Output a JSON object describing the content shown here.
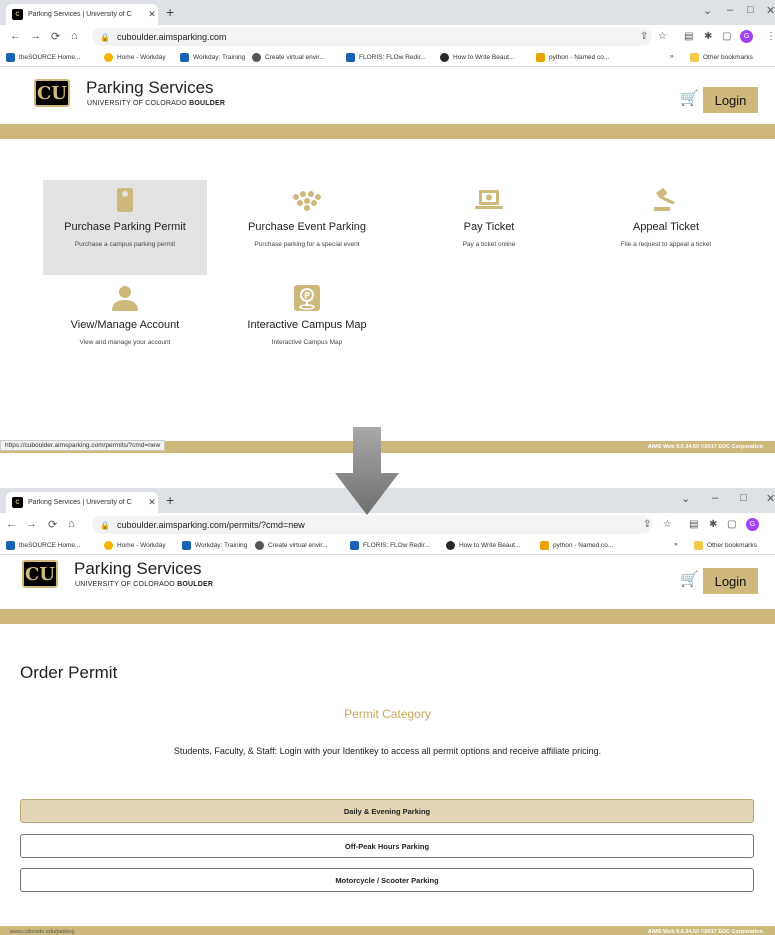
{
  "browser_before": {
    "tab_title": "Parking Services | University of C",
    "tab_close": "✕",
    "new_tab": "+",
    "url": "cuboulder.aimsparking.com",
    "status_url": "https://cuboulder.aimsparking.com/permits/?cmd=new"
  },
  "browser_after": {
    "tab_title": "Parking Services | University of C",
    "tab_close": "✕",
    "new_tab": "+",
    "url": "cuboulder.aimsparking.com/permits/?cmd=new"
  },
  "bookmarks": [
    {
      "label": "theSOURCE Home...",
      "icon": "source-icon"
    },
    {
      "label": "Home - Workday",
      "icon": "workday-icon"
    },
    {
      "label": "Workday: Training",
      "icon": "workday-training-icon"
    },
    {
      "label": "Create virtual envir...",
      "icon": "chrome-icon"
    },
    {
      "label": "FLORIS: FLOw Redir...",
      "icon": "floris-icon"
    },
    {
      "label": "How to Write Beaut...",
      "icon": "github-icon"
    },
    {
      "label": "python - Named co...",
      "icon": "python-icon"
    }
  ],
  "bookmarks_more": "»",
  "other_bookmarks": "Other bookmarks",
  "avatar_letter": "G",
  "site": {
    "title": "Parking Services",
    "subtitle_plain": "UNIVERSITY OF COLORADO",
    "subtitle_bold": "BOULDER",
    "login": "Login",
    "logo_letters": "CU"
  },
  "tiles": [
    {
      "title": "Purchase Parking Permit",
      "sub": "Purchase a campus parking permit",
      "icon": "door-hanger-icon"
    },
    {
      "title": "Purchase Event Parking",
      "sub": "Purchase parking for a special event",
      "icon": "crowd-icon"
    },
    {
      "title": "Pay Ticket",
      "sub": "Pay a ticket online",
      "icon": "laptop-pay-icon"
    },
    {
      "title": "Appeal Ticket",
      "sub": "File a request to appeal a ticket",
      "icon": "gavel-icon"
    },
    {
      "title": "View/Manage Account",
      "sub": "View and manage your account",
      "icon": "user-icon"
    },
    {
      "title": "Interactive Campus Map",
      "sub": "Interactive Campus Map",
      "icon": "map-pin-icon"
    }
  ],
  "footer_copyright": "AIMS Web 9.0.34.50 ©2017 EDC Corporation",
  "footer_link": "www.colorado.edu/parking",
  "permit": {
    "heading": "Order Permit",
    "category_title": "Permit Category",
    "note": "Students, Faculty, & Staff: Login with your Identikey to access all permit options and receive affiliate pricing.",
    "options": [
      "Daily & Evening Parking",
      "Off-Peak Hours Parking",
      "Motorcycle / Scooter Parking"
    ]
  },
  "colors": {
    "gold": "#cfb87c",
    "gold_text": "#c9a75a",
    "selected_tile": "#e3e3e3",
    "active_option": "#e2d6b5"
  }
}
